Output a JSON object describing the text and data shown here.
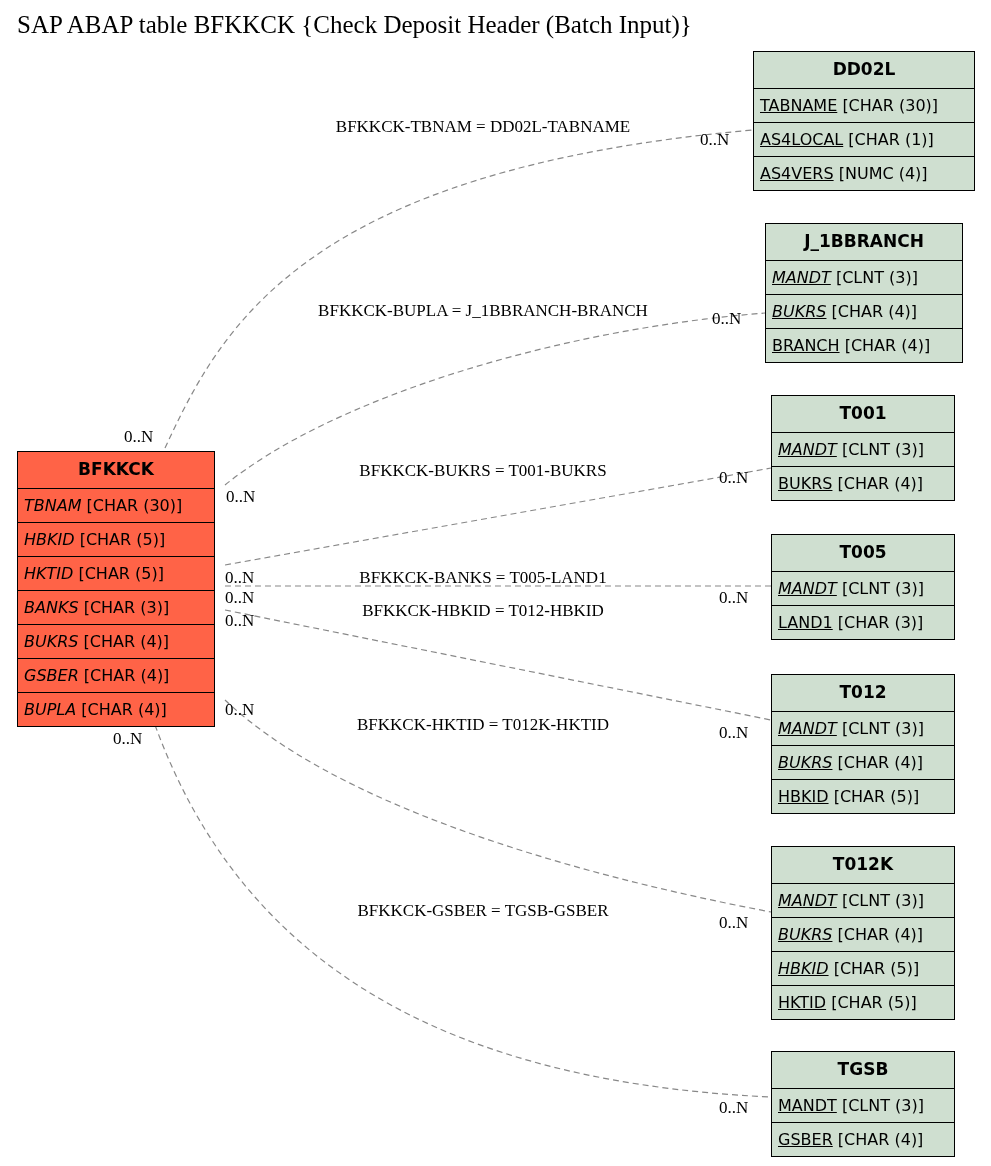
{
  "title": "SAP ABAP table BFKKCK {Check Deposit Header (Batch Input)}",
  "main_table": {
    "name": "BFKKCK",
    "fields": [
      {
        "name": "TBNAM",
        "type": "[CHAR (30)]",
        "key": false,
        "foreign": true
      },
      {
        "name": "HBKID",
        "type": "[CHAR (5)]",
        "key": false,
        "foreign": true
      },
      {
        "name": "HKTID",
        "type": "[CHAR (5)]",
        "key": false,
        "foreign": true
      },
      {
        "name": "BANKS",
        "type": "[CHAR (3)]",
        "key": false,
        "foreign": true
      },
      {
        "name": "BUKRS",
        "type": "[CHAR (4)]",
        "key": false,
        "foreign": true
      },
      {
        "name": "GSBER",
        "type": "[CHAR (4)]",
        "key": false,
        "foreign": true
      },
      {
        "name": "BUPLA",
        "type": "[CHAR (4)]",
        "key": false,
        "foreign": true
      }
    ]
  },
  "tables": [
    {
      "name": "DD02L",
      "fields": [
        {
          "name": "TABNAME",
          "type": "[CHAR (30)]",
          "key": true,
          "foreign": false
        },
        {
          "name": "AS4LOCAL",
          "type": "[CHAR (1)]",
          "key": true,
          "foreign": false
        },
        {
          "name": "AS4VERS",
          "type": "[NUMC (4)]",
          "key": true,
          "foreign": false
        }
      ]
    },
    {
      "name": "J_1BBRANCH",
      "fields": [
        {
          "name": "MANDT",
          "type": "[CLNT (3)]",
          "key": true,
          "foreign": true
        },
        {
          "name": "BUKRS",
          "type": "[CHAR (4)]",
          "key": true,
          "foreign": true
        },
        {
          "name": "BRANCH",
          "type": "[CHAR (4)]",
          "key": true,
          "foreign": false
        }
      ]
    },
    {
      "name": "T001",
      "fields": [
        {
          "name": "MANDT",
          "type": "[CLNT (3)]",
          "key": true,
          "foreign": true
        },
        {
          "name": "BUKRS",
          "type": "[CHAR (4)]",
          "key": true,
          "foreign": false
        }
      ]
    },
    {
      "name": "T005",
      "fields": [
        {
          "name": "MANDT",
          "type": "[CLNT (3)]",
          "key": true,
          "foreign": true
        },
        {
          "name": "LAND1",
          "type": "[CHAR (3)]",
          "key": true,
          "foreign": false
        }
      ]
    },
    {
      "name": "T012",
      "fields": [
        {
          "name": "MANDT",
          "type": "[CLNT (3)]",
          "key": true,
          "foreign": true
        },
        {
          "name": "BUKRS",
          "type": "[CHAR (4)]",
          "key": true,
          "foreign": true
        },
        {
          "name": "HBKID",
          "type": "[CHAR (5)]",
          "key": true,
          "foreign": false
        }
      ]
    },
    {
      "name": "T012K",
      "fields": [
        {
          "name": "MANDT",
          "type": "[CLNT (3)]",
          "key": true,
          "foreign": true
        },
        {
          "name": "BUKRS",
          "type": "[CHAR (4)]",
          "key": true,
          "foreign": true
        },
        {
          "name": "HBKID",
          "type": "[CHAR (5)]",
          "key": true,
          "foreign": true
        },
        {
          "name": "HKTID",
          "type": "[CHAR (5)]",
          "key": true,
          "foreign": false
        }
      ]
    },
    {
      "name": "TGSB",
      "fields": [
        {
          "name": "MANDT",
          "type": "[CLNT (3)]",
          "key": true,
          "foreign": false
        },
        {
          "name": "GSBER",
          "type": "[CHAR (4)]",
          "key": true,
          "foreign": false
        }
      ]
    }
  ],
  "relations": [
    {
      "label": "BFKKCK-TBNAM = DD02L-TABNAME",
      "from_cardinality": "0..N",
      "to_cardinality": "0..N"
    },
    {
      "label": "BFKKCK-BUPLA = J_1BBRANCH-BRANCH",
      "from_cardinality": "0..N",
      "to_cardinality": "0..N"
    },
    {
      "label": "BFKKCK-BUKRS = T001-BUKRS",
      "from_cardinality": "0..N",
      "to_cardinality": "0..N"
    },
    {
      "label": "BFKKCK-BANKS = T005-LAND1",
      "from_cardinality": "0..N",
      "to_cardinality": "0..N"
    },
    {
      "label": "BFKKCK-HBKID = T012-HBKID",
      "from_cardinality": "0..N",
      "to_cardinality": "0..N"
    },
    {
      "label": "BFKKCK-HKTID = T012K-HKTID",
      "from_cardinality": "0..N",
      "to_cardinality": "0..N"
    },
    {
      "label": "BFKKCK-GSBER = TGSB-GSBER",
      "from_cardinality": "0..N",
      "to_cardinality": "0..N"
    }
  ]
}
